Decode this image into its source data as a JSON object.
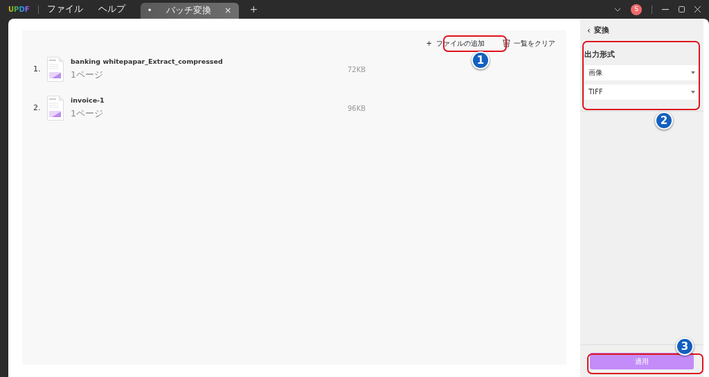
{
  "app": {
    "logo": "UPDF",
    "menu": [
      "ファイル",
      "ヘルプ"
    ]
  },
  "tabs": [
    {
      "dot": "•",
      "label": "バッチ変換",
      "close": "×",
      "selected": true
    }
  ],
  "new_tab": "+",
  "user": {
    "initial": "S"
  },
  "toolbar": {
    "add": {
      "icon": "+",
      "label": "ファイルの追加"
    },
    "clear": {
      "label": "一覧をクリア"
    }
  },
  "files": [
    {
      "index": "1.",
      "name": "banking whitepapar_Extract_compressed",
      "pages": "1ページ",
      "size": "72KB"
    },
    {
      "index": "2.",
      "name": "invoice-1",
      "pages": "1ページ",
      "size": "96KB"
    }
  ],
  "panel": {
    "back": "‹",
    "title": "変換",
    "section": "出力形式",
    "selects": [
      {
        "value": "画像"
      },
      {
        "value": "TIFF"
      }
    ],
    "apply": "適用"
  },
  "callouts": [
    {
      "number": "1"
    },
    {
      "number": "2"
    },
    {
      "number": "3"
    }
  ]
}
